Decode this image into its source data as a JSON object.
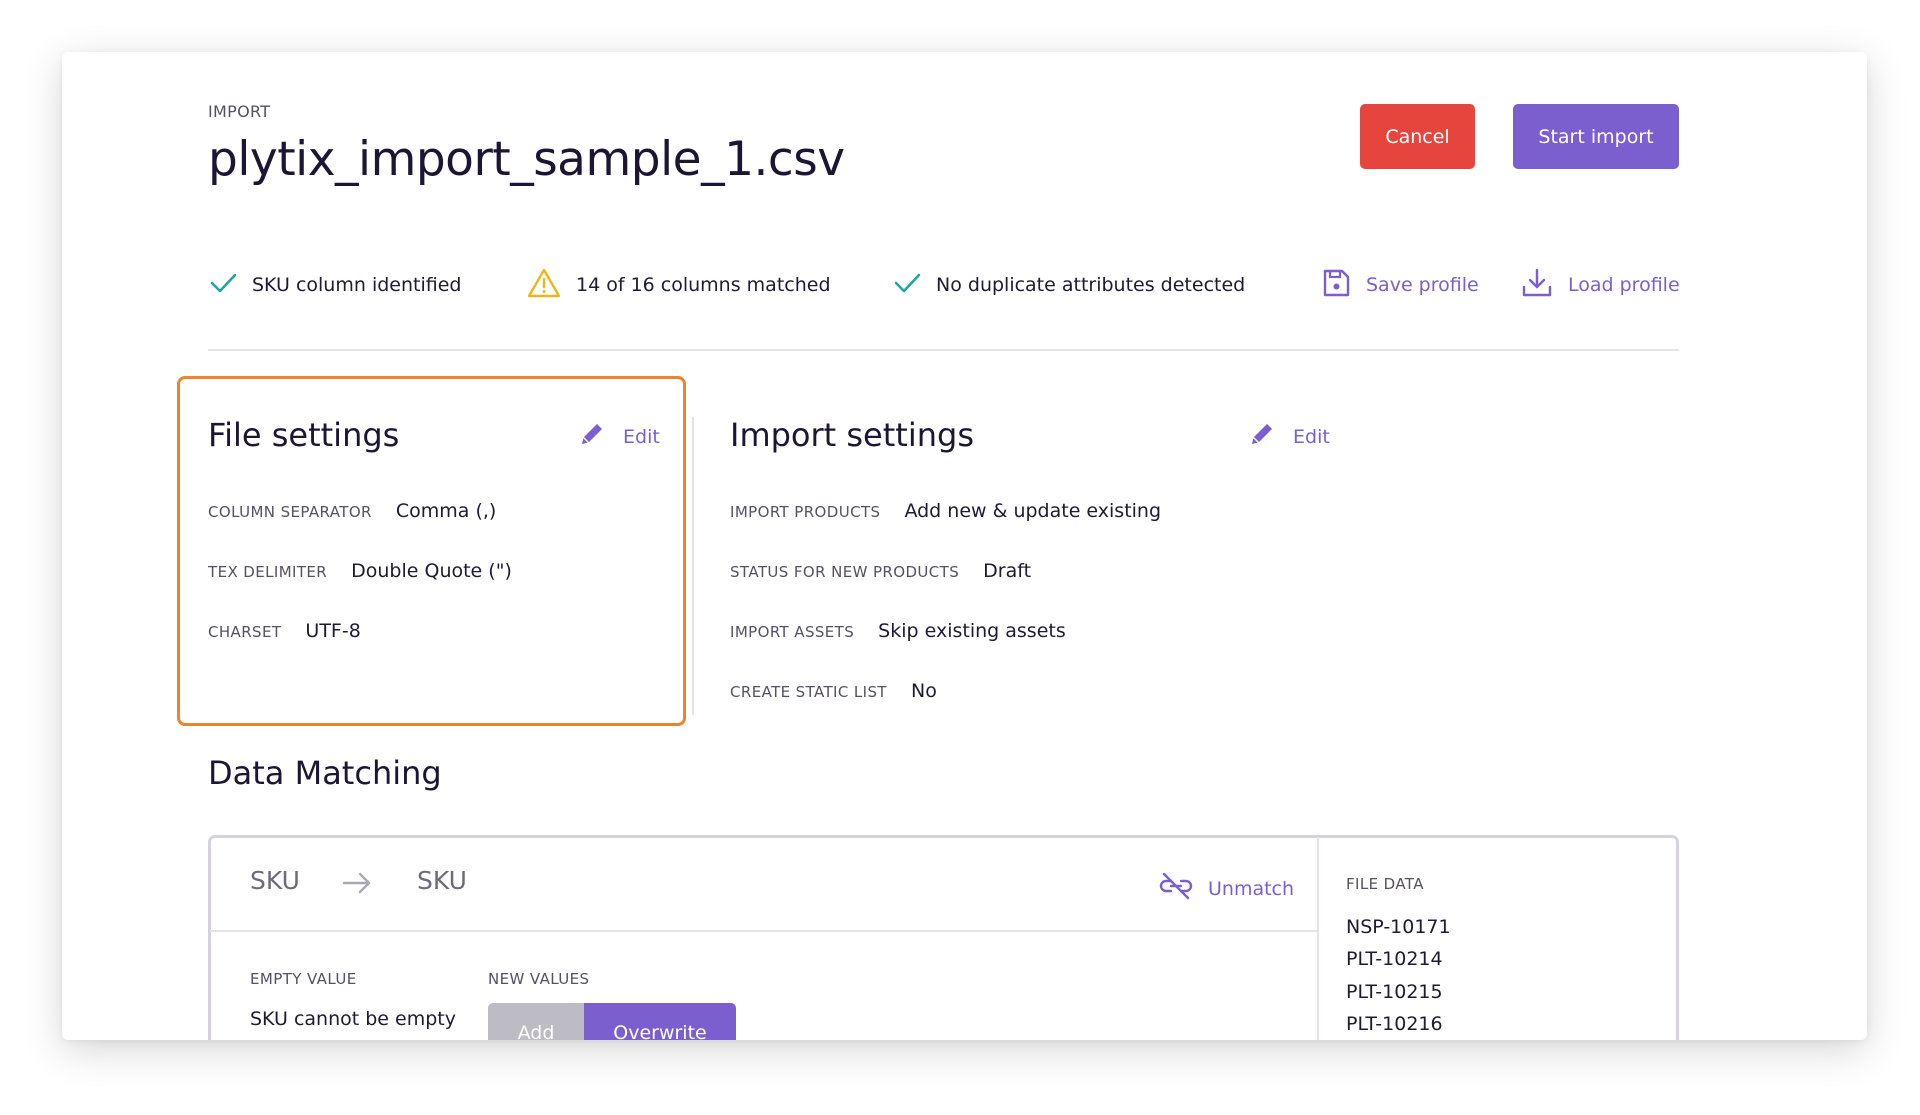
{
  "header": {
    "eyebrow": "IMPORT",
    "title": "plytix_import_sample_1.csv",
    "cancel_label": "Cancel",
    "start_label": "Start import"
  },
  "status": {
    "sku": "SKU column identified",
    "columns": "14 of 16 columns matched",
    "duplicates": "No duplicate attributes detected",
    "save_profile": "Save profile",
    "load_profile": "Load profile"
  },
  "file_settings": {
    "title": "File settings",
    "edit": "Edit",
    "fields": [
      {
        "label": "COLUMN SEPARATOR",
        "value": "Comma (,)"
      },
      {
        "label": "TEX DELIMITER",
        "value": "Double Quote (\")"
      },
      {
        "label": "CHARSET",
        "value": "UTF-8"
      }
    ]
  },
  "import_settings": {
    "title": "Import settings",
    "edit": "Edit",
    "fields": [
      {
        "label": "IMPORT PRODUCTS",
        "value": "Add new & update existing"
      },
      {
        "label": "STATUS FOR NEW PRODUCTS",
        "value": "Draft"
      },
      {
        "label": "IMPORT ASSETS",
        "value": "Skip existing assets"
      },
      {
        "label": "CREATE STATIC LIST",
        "value": "No"
      }
    ]
  },
  "data_matching": {
    "title": "Data Matching",
    "source": "SKU",
    "target": "SKU",
    "unmatch": "Unmatch",
    "empty_value_label": "EMPTY VALUE",
    "empty_value_text": "SKU cannot be empty",
    "new_values_label": "NEW VALUES",
    "add_label": "Add",
    "overwrite_label": "Overwrite",
    "file_data_label": "FILE DATA",
    "file_data": [
      "NSP-10171",
      "PLT-10214",
      "PLT-10215",
      "PLT-10216"
    ]
  },
  "colors": {
    "accent": "#7b5fce",
    "cancel": "#e5453d",
    "check": "#1fa89a",
    "warning": "#f2b41b",
    "highlight": "#f0822b"
  }
}
